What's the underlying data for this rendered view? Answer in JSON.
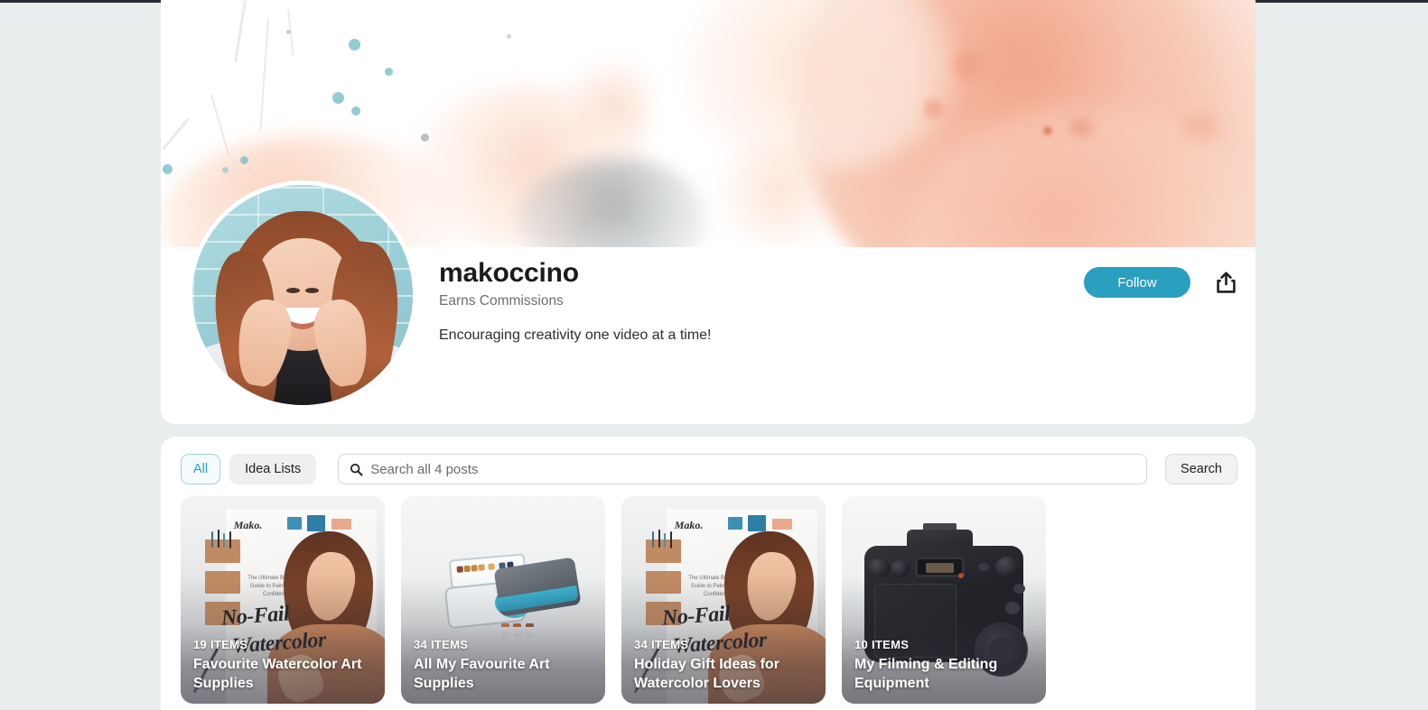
{
  "theme": {
    "page_bg": "#e9edee",
    "panel_bg": "#ffffff",
    "accent": "#2a9fc0",
    "text_primary": "#1b1b1b",
    "text_muted": "#6f6f6f",
    "banner_peach": "#f4ac92",
    "banner_teal": "#7cc1cb"
  },
  "profile": {
    "username": "makoccino",
    "commissions_label": "Earns Commissions",
    "tagline": "Encouraging creativity one video at a time!",
    "avatar_alt": "makoccino profile photo",
    "follow_label": "Follow",
    "share_icon": "share-icon"
  },
  "toolbar": {
    "filters": [
      {
        "label": "All",
        "active": true
      },
      {
        "label": "Idea Lists",
        "active": false
      }
    ],
    "search": {
      "icon": "search-icon",
      "placeholder": "Search all 4 posts",
      "value": ""
    },
    "search_button_label": "Search"
  },
  "cards": [
    {
      "count_label": "19 ITEMS",
      "title": "Favourite Watercolor Art Supplies",
      "art": "book-cover",
      "book": {
        "brand": "Mako.",
        "brand_sub": "The Ultimate Watercolor",
        "subtitle": "The Ultimate Beginner's Guide to Painting with Confidence",
        "title_line1": "No-Fail",
        "title_line2": "Watercolor"
      }
    },
    {
      "count_label": "34 ITEMS",
      "title": "All My Favourite Art Supplies",
      "art": "art-supplies"
    },
    {
      "count_label": "34 ITEMS",
      "title": "Holiday Gift Ideas for Watercolor Lovers",
      "art": "book-cover",
      "book": {
        "brand": "Mako.",
        "brand_sub": "The Ultimate Watercolor",
        "subtitle": "The Ultimate Beginner's Guide to Painting with Confidence",
        "title_line1": "No-Fail",
        "title_line2": "Watercolor"
      }
    },
    {
      "count_label": "10 ITEMS",
      "title": "My Filming & Editing Equipment",
      "art": "camera"
    }
  ]
}
